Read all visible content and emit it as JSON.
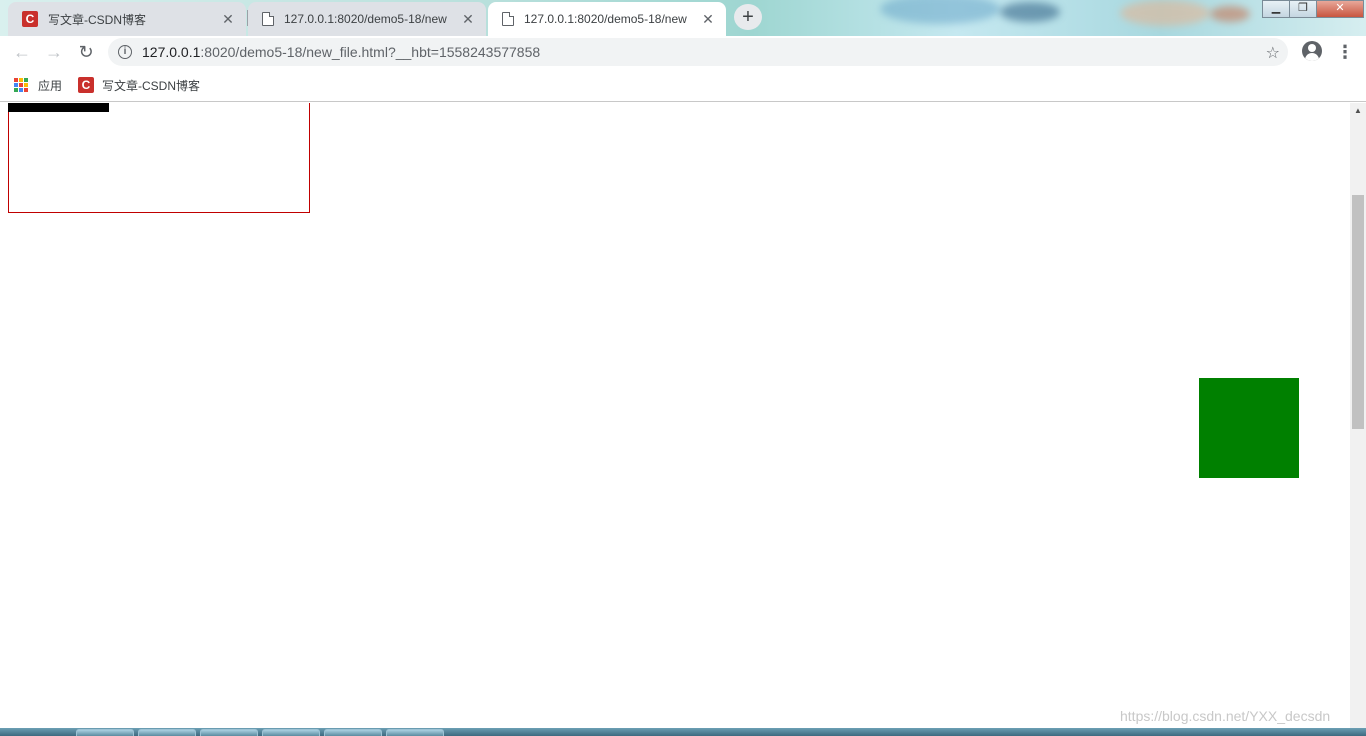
{
  "tabs": [
    {
      "label": "写文章-CSDN博客",
      "icon": "csdn-icon",
      "active": false
    },
    {
      "label": "127.0.0.1:8020/demo5-18/new",
      "icon": "file-icon",
      "active": false
    },
    {
      "label": "127.0.0.1:8020/demo5-18/new",
      "icon": "file-icon",
      "active": true
    }
  ],
  "toolbar": {
    "url_host": "127.0.0.1",
    "url_rest": ":8020/demo5-18/new_file.html?__hbt=1558243577858"
  },
  "bookmarks": [
    {
      "label": "应用",
      "icon": "apps-icon"
    },
    {
      "label": "写文章-CSDN博客",
      "icon": "csdn-icon"
    }
  ],
  "page": {
    "colors": {
      "box_border": "#c00000",
      "bar": "#000000",
      "square": "#008000"
    }
  },
  "watermark": "https://blog.csdn.net/YXX_decsdn"
}
